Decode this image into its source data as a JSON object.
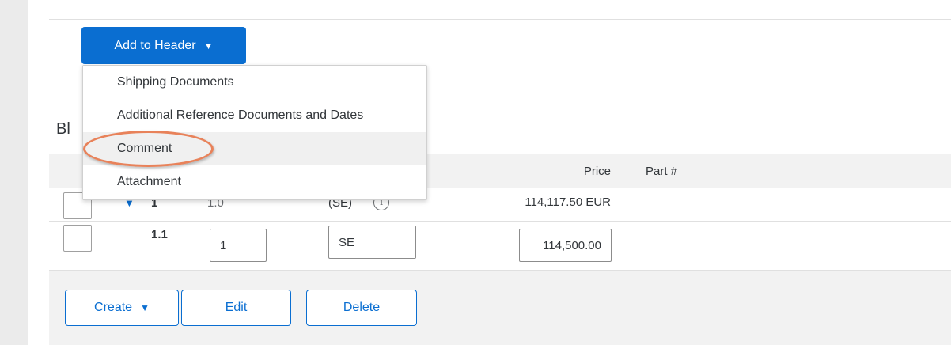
{
  "header_button": {
    "label": "Add to Header",
    "caret": "▼"
  },
  "section": {
    "title": "Bl"
  },
  "dropdown_menu": {
    "items": [
      {
        "label": "Shipping Documents"
      },
      {
        "label": "Additional Reference Documents and Dates"
      },
      {
        "label": "Comment"
      },
      {
        "label": "Attachment"
      }
    ]
  },
  "table": {
    "columns": {
      "price": "Price",
      "part": "Part #"
    },
    "rows": [
      {
        "line": "1",
        "qty": "1.0",
        "unit": "(SE)",
        "price": "114,117.50 EUR",
        "expand_icon": "triangle-down-icon",
        "info_icon": "info-icon"
      },
      {
        "line": "1.1",
        "qty": "1",
        "unit": "SE",
        "price": "114,500.00"
      }
    ]
  },
  "footer": {
    "create_label": "Create",
    "create_caret": "▼",
    "edit_label": "Edit",
    "delete_label": "Delete"
  },
  "colors": {
    "accent": "#0a6ed1",
    "highlight": "#e8825a",
    "header_bg": "#f2f2f2"
  }
}
